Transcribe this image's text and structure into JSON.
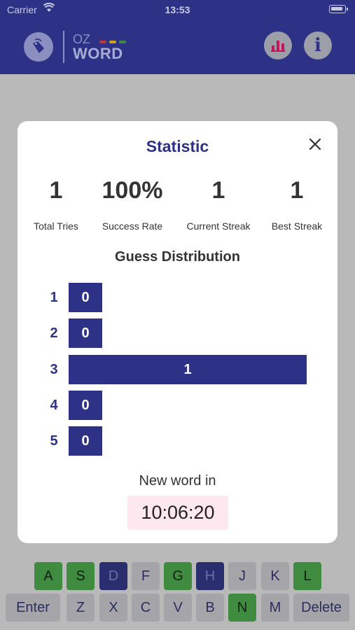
{
  "status_bar": {
    "carrier": "Carrier",
    "time": "13:53"
  },
  "header": {
    "logo": {
      "top": "OZ",
      "bottom": "WORD",
      "dash_colors": [
        "#c0392b",
        "#d4a017",
        "#3f8b3f"
      ]
    },
    "stats_icon": "bar-chart-icon",
    "info_icon": "info-icon",
    "info_glyph": "i"
  },
  "keyboard": {
    "row3": [
      {
        "label": "A",
        "state": "correct"
      },
      {
        "label": "S",
        "state": "correct"
      },
      {
        "label": "D",
        "state": "absent"
      },
      {
        "label": "F",
        "state": "unused"
      },
      {
        "label": "G",
        "state": "correct"
      },
      {
        "label": "H",
        "state": "absent"
      },
      {
        "label": "J",
        "state": "unused"
      },
      {
        "label": "K",
        "state": "unused"
      },
      {
        "label": "L",
        "state": "correct"
      }
    ],
    "row4": [
      {
        "label": "Enter",
        "state": "unused"
      },
      {
        "label": "Z",
        "state": "unused"
      },
      {
        "label": "X",
        "state": "unused"
      },
      {
        "label": "C",
        "state": "unused"
      },
      {
        "label": "V",
        "state": "unused"
      },
      {
        "label": "B",
        "state": "unused"
      },
      {
        "label": "N",
        "state": "correct"
      },
      {
        "label": "M",
        "state": "unused"
      },
      {
        "label": "Delete",
        "state": "unused"
      }
    ]
  },
  "modal": {
    "title": "Statistic",
    "close_icon": "close-icon",
    "stats": [
      {
        "value": "1",
        "label": "Total Tries"
      },
      {
        "value": "100%",
        "label": "Success Rate"
      },
      {
        "value": "1",
        "label": "Current Streak"
      },
      {
        "value": "1",
        "label": "Best Streak"
      }
    ],
    "distribution_title": "Guess Distribution",
    "distribution": [
      {
        "guess": "1",
        "count": "0"
      },
      {
        "guess": "2",
        "count": "0"
      },
      {
        "guess": "3",
        "count": "1"
      },
      {
        "guess": "4",
        "count": "0"
      },
      {
        "guess": "5",
        "count": "0"
      }
    ],
    "new_word_label": "New word in",
    "countdown": "10:06:20"
  },
  "colors": {
    "brand": "#2d3286",
    "correct": "#3f8b3f",
    "absent": "#2a2e6e",
    "timer_bg": "#fde8f0"
  }
}
